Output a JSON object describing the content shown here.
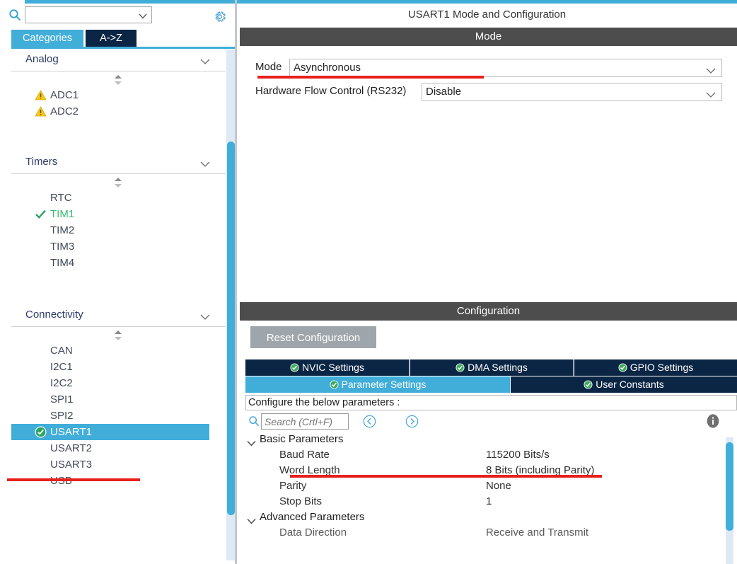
{
  "sidebar": {
    "search": {
      "value": "",
      "placeholder": ""
    },
    "icons": {
      "search": "search-icon",
      "gear": "gear-icon"
    },
    "tabs": [
      {
        "label": "Categories",
        "active": true
      },
      {
        "label": "A->Z",
        "active": false
      }
    ],
    "groups": [
      {
        "name": "Analog",
        "items": [
          {
            "label": "ADC1",
            "status": "warning"
          },
          {
            "label": "ADC2",
            "status": "warning"
          }
        ]
      },
      {
        "name": "Timers",
        "items": [
          {
            "label": "RTC",
            "status": "none"
          },
          {
            "label": "TIM1",
            "status": "check"
          },
          {
            "label": "TIM2",
            "status": "none"
          },
          {
            "label": "TIM3",
            "status": "none"
          },
          {
            "label": "TIM4",
            "status": "none"
          }
        ]
      },
      {
        "name": "Connectivity",
        "items": [
          {
            "label": "CAN",
            "status": "none"
          },
          {
            "label": "I2C1",
            "status": "none"
          },
          {
            "label": "I2C2",
            "status": "none"
          },
          {
            "label": "SPI1",
            "status": "none"
          },
          {
            "label": "SPI2",
            "status": "none"
          },
          {
            "label": "USART1",
            "status": "ok",
            "selected": true
          },
          {
            "label": "USART2",
            "status": "none"
          },
          {
            "label": "USART3",
            "status": "none"
          },
          {
            "label": "USB",
            "status": "none"
          }
        ]
      }
    ]
  },
  "panel": {
    "title": "USART1 Mode and Configuration",
    "mode_section_title": "Mode",
    "configuration_section_title": "Configuration",
    "mode_fields": [
      {
        "label": "Mode",
        "value": "Asynchronous"
      },
      {
        "label": "Hardware Flow Control (RS232)",
        "value": "Disable"
      }
    ],
    "reset_button": "Reset Configuration",
    "config_tabs_row1": [
      {
        "label": "NVIC Settings",
        "active": false,
        "status": "ok"
      },
      {
        "label": "DMA Settings",
        "active": false,
        "status": "ok"
      },
      {
        "label": "GPIO Settings",
        "active": false,
        "status": "ok"
      }
    ],
    "config_tabs_row2": [
      {
        "label": "Parameter Settings",
        "active": true,
        "status": "ok"
      },
      {
        "label": "User Constants",
        "active": false,
        "status": "ok"
      }
    ],
    "hint": "Configure the below parameters :",
    "param_search": {
      "placeholder": "Search (Crtl+F)",
      "value": ""
    },
    "nav_icons": {
      "prev": "chevron-left-circle-icon",
      "next": "chevron-right-circle-icon",
      "info": "info-icon"
    },
    "parameters": [
      {
        "type": "group",
        "label": "Basic Parameters"
      },
      {
        "type": "row",
        "name": "Baud Rate",
        "value": "115200 Bits/s"
      },
      {
        "type": "row",
        "name": "Word Length",
        "value": "8 Bits (including Parity)"
      },
      {
        "type": "row",
        "name": "Parity",
        "value": "None"
      },
      {
        "type": "row",
        "name": "Stop Bits",
        "value": "1"
      },
      {
        "type": "group",
        "label": "Advanced Parameters"
      },
      {
        "type": "row",
        "name": "Data Direction",
        "value": "Receive and Transmit",
        "clipped": true
      }
    ]
  },
  "colors": {
    "accent_blue": "#41add9",
    "tab_navy": "#0b2545",
    "section_gray": "#4d4d4d",
    "annotation_red": "#e8201b",
    "warning_yellow": "#f7c81a",
    "ok_green": "#3bb878",
    "reset_gray": "#9fa6ab"
  }
}
